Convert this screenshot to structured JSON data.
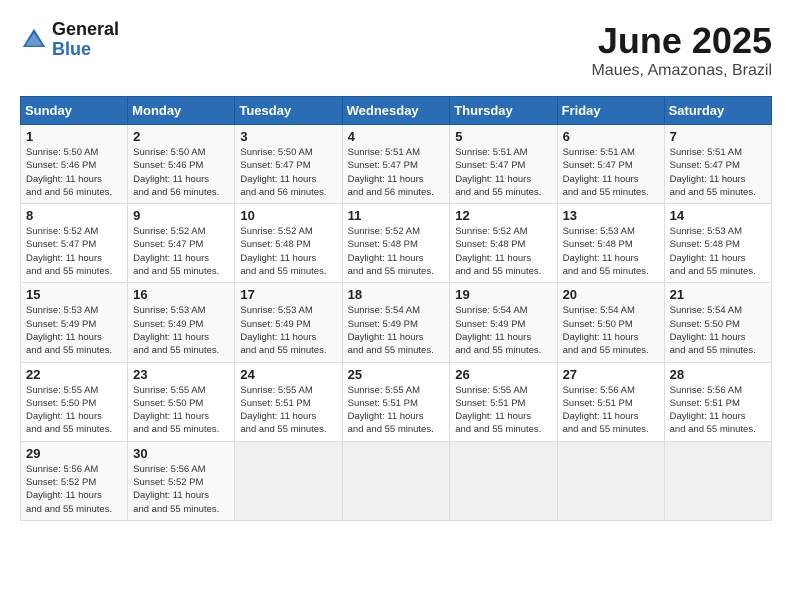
{
  "header": {
    "logo_general": "General",
    "logo_blue": "Blue",
    "month_title": "June 2025",
    "location": "Maues, Amazonas, Brazil"
  },
  "days_of_week": [
    "Sunday",
    "Monday",
    "Tuesday",
    "Wednesday",
    "Thursday",
    "Friday",
    "Saturday"
  ],
  "weeks": [
    [
      {
        "day": "1",
        "sunrise": "5:50 AM",
        "sunset": "5:46 PM",
        "daylight": "11 hours and 56 minutes."
      },
      {
        "day": "2",
        "sunrise": "5:50 AM",
        "sunset": "5:46 PM",
        "daylight": "11 hours and 56 minutes."
      },
      {
        "day": "3",
        "sunrise": "5:50 AM",
        "sunset": "5:47 PM",
        "daylight": "11 hours and 56 minutes."
      },
      {
        "day": "4",
        "sunrise": "5:51 AM",
        "sunset": "5:47 PM",
        "daylight": "11 hours and 56 minutes."
      },
      {
        "day": "5",
        "sunrise": "5:51 AM",
        "sunset": "5:47 PM",
        "daylight": "11 hours and 55 minutes."
      },
      {
        "day": "6",
        "sunrise": "5:51 AM",
        "sunset": "5:47 PM",
        "daylight": "11 hours and 55 minutes."
      },
      {
        "day": "7",
        "sunrise": "5:51 AM",
        "sunset": "5:47 PM",
        "daylight": "11 hours and 55 minutes."
      }
    ],
    [
      {
        "day": "8",
        "sunrise": "5:52 AM",
        "sunset": "5:47 PM",
        "daylight": "11 hours and 55 minutes."
      },
      {
        "day": "9",
        "sunrise": "5:52 AM",
        "sunset": "5:47 PM",
        "daylight": "11 hours and 55 minutes."
      },
      {
        "day": "10",
        "sunrise": "5:52 AM",
        "sunset": "5:48 PM",
        "daylight": "11 hours and 55 minutes."
      },
      {
        "day": "11",
        "sunrise": "5:52 AM",
        "sunset": "5:48 PM",
        "daylight": "11 hours and 55 minutes."
      },
      {
        "day": "12",
        "sunrise": "5:52 AM",
        "sunset": "5:48 PM",
        "daylight": "11 hours and 55 minutes."
      },
      {
        "day": "13",
        "sunrise": "5:53 AM",
        "sunset": "5:48 PM",
        "daylight": "11 hours and 55 minutes."
      },
      {
        "day": "14",
        "sunrise": "5:53 AM",
        "sunset": "5:48 PM",
        "daylight": "11 hours and 55 minutes."
      }
    ],
    [
      {
        "day": "15",
        "sunrise": "5:53 AM",
        "sunset": "5:49 PM",
        "daylight": "11 hours and 55 minutes."
      },
      {
        "day": "16",
        "sunrise": "5:53 AM",
        "sunset": "5:49 PM",
        "daylight": "11 hours and 55 minutes."
      },
      {
        "day": "17",
        "sunrise": "5:53 AM",
        "sunset": "5:49 PM",
        "daylight": "11 hours and 55 minutes."
      },
      {
        "day": "18",
        "sunrise": "5:54 AM",
        "sunset": "5:49 PM",
        "daylight": "11 hours and 55 minutes."
      },
      {
        "day": "19",
        "sunrise": "5:54 AM",
        "sunset": "5:49 PM",
        "daylight": "11 hours and 55 minutes."
      },
      {
        "day": "20",
        "sunrise": "5:54 AM",
        "sunset": "5:50 PM",
        "daylight": "11 hours and 55 minutes."
      },
      {
        "day": "21",
        "sunrise": "5:54 AM",
        "sunset": "5:50 PM",
        "daylight": "11 hours and 55 minutes."
      }
    ],
    [
      {
        "day": "22",
        "sunrise": "5:55 AM",
        "sunset": "5:50 PM",
        "daylight": "11 hours and 55 minutes."
      },
      {
        "day": "23",
        "sunrise": "5:55 AM",
        "sunset": "5:50 PM",
        "daylight": "11 hours and 55 minutes."
      },
      {
        "day": "24",
        "sunrise": "5:55 AM",
        "sunset": "5:51 PM",
        "daylight": "11 hours and 55 minutes."
      },
      {
        "day": "25",
        "sunrise": "5:55 AM",
        "sunset": "5:51 PM",
        "daylight": "11 hours and 55 minutes."
      },
      {
        "day": "26",
        "sunrise": "5:55 AM",
        "sunset": "5:51 PM",
        "daylight": "11 hours and 55 minutes."
      },
      {
        "day": "27",
        "sunrise": "5:56 AM",
        "sunset": "5:51 PM",
        "daylight": "11 hours and 55 minutes."
      },
      {
        "day": "28",
        "sunrise": "5:56 AM",
        "sunset": "5:51 PM",
        "daylight": "11 hours and 55 minutes."
      }
    ],
    [
      {
        "day": "29",
        "sunrise": "5:56 AM",
        "sunset": "5:52 PM",
        "daylight": "11 hours and 55 minutes."
      },
      {
        "day": "30",
        "sunrise": "5:56 AM",
        "sunset": "5:52 PM",
        "daylight": "11 hours and 55 minutes."
      },
      null,
      null,
      null,
      null,
      null
    ]
  ],
  "labels": {
    "sunrise_prefix": "Sunrise: ",
    "sunset_prefix": "Sunset: ",
    "daylight_prefix": "Daylight: "
  }
}
